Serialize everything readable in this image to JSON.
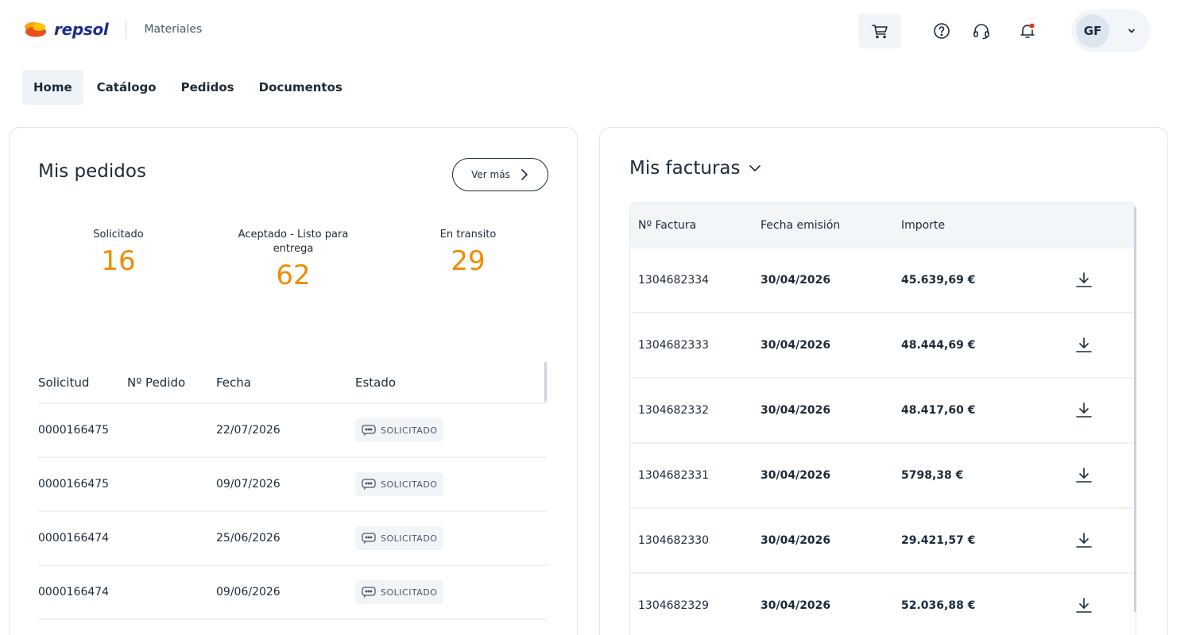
{
  "brand": {
    "logo_text": "repsol",
    "app_name": "Materiales"
  },
  "header": {
    "icons": [
      "cart-icon",
      "help-icon",
      "headset-icon",
      "bell-icon",
      "chevron-down-icon"
    ],
    "user_initials": "GF",
    "notification_color": "#e5322d"
  },
  "nav": {
    "items": [
      {
        "label": "Home"
      },
      {
        "label": "Catálogo"
      },
      {
        "label": "Pedidos"
      },
      {
        "label": "Documentos"
      }
    ]
  },
  "orders": {
    "title": "Mis pedidos",
    "ver_mas": "Ver más",
    "stats": [
      {
        "label": "Solicitado",
        "value": "16"
      },
      {
        "label": "Aceptado - Listo para entrega",
        "value": "62"
      },
      {
        "label": "En transito",
        "value": "29"
      }
    ],
    "columns": [
      "Solicitud",
      "Nº Pedido",
      "Fecha",
      "Estado"
    ],
    "rows": [
      {
        "solicitud": "0000166475",
        "pedido": "",
        "fecha": "22/07/2026",
        "estado": "SOLICITADO"
      },
      {
        "solicitud": "0000166475",
        "pedido": "",
        "fecha": "09/07/2026",
        "estado": "SOLICITADO"
      },
      {
        "solicitud": "0000166474",
        "pedido": "",
        "fecha": "25/06/2026",
        "estado": "SOLICITADO"
      },
      {
        "solicitud": "0000166474",
        "pedido": "",
        "fecha": "09/06/2026",
        "estado": "SOLICITADO"
      }
    ]
  },
  "invoices": {
    "title": "Mis facturas",
    "columns": [
      "Nº Factura",
      "Fecha emisión",
      "Importe"
    ],
    "rows": [
      {
        "numero": "1304682334",
        "fecha": "30/04/2026",
        "importe": "45.639,69 €"
      },
      {
        "numero": "1304682333",
        "fecha": "30/04/2026",
        "importe": "48.444,69 €"
      },
      {
        "numero": "1304682332",
        "fecha": "30/04/2026",
        "importe": "48.417,60 €"
      },
      {
        "numero": "1304682331",
        "fecha": "30/04/2026",
        "importe": "5798,38 €"
      },
      {
        "numero": "1304682330",
        "fecha": "30/04/2026",
        "importe": "29.421,57 €"
      },
      {
        "numero": "1304682329",
        "fecha": "30/04/2026",
        "importe": "52.036,88 €"
      }
    ]
  },
  "colors": {
    "accent_orange": "#f08c00",
    "text_dark": "#1b2b3a",
    "brand_navy": "#1e2f8c"
  }
}
